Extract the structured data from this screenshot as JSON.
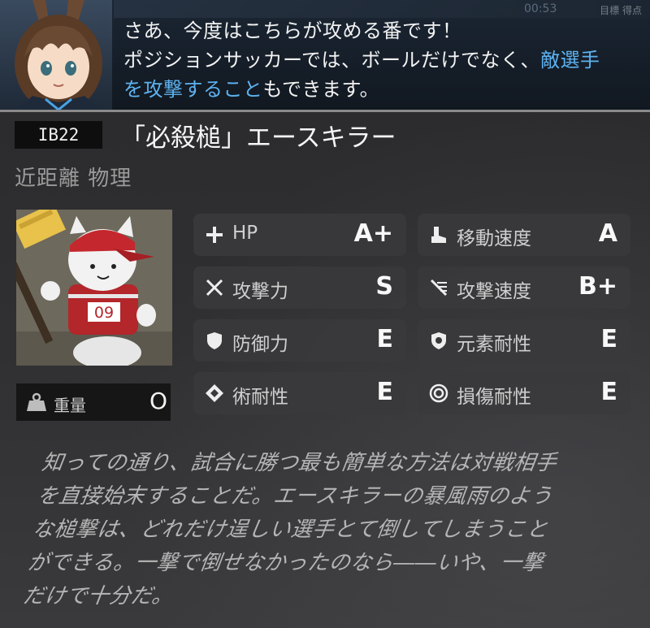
{
  "dialog": {
    "hud_timer": "00:53",
    "hud_score": "目標 得点",
    "line1": "さあ、今度はこちらが攻める番です！",
    "line2_a": "ポジションサッカーでは、ボールだけでなく、",
    "line2_hl": "敵選手",
    "line3_hl": "を攻撃すること",
    "line3_b": "もできます。"
  },
  "unit": {
    "code": "IB22",
    "name": "「必殺槌」エースキラー",
    "tags": "近距離 物理"
  },
  "card": {
    "jersey_number": "09"
  },
  "weight": {
    "label": "重量",
    "value": "O"
  },
  "stats": [
    {
      "icon": "plus-icon",
      "label": "HP",
      "value": "A+"
    },
    {
      "icon": "boot-icon",
      "label": "移動速度",
      "value": "A"
    },
    {
      "icon": "crossed-swords-icon",
      "label": "攻撃力",
      "value": "S"
    },
    {
      "icon": "attack-speed-icon",
      "label": "攻撃速度",
      "value": "B+"
    },
    {
      "icon": "shield-icon",
      "label": "防御力",
      "value": "E"
    },
    {
      "icon": "element-res-icon",
      "label": "元素耐性",
      "value": "E"
    },
    {
      "icon": "arts-res-icon",
      "label": "術耐性",
      "value": "E"
    },
    {
      "icon": "damage-res-icon",
      "label": "損傷耐性",
      "value": "E"
    }
  ],
  "description": [
    "知っての通り、試合に勝つ最も簡単な方法は対戦相手",
    "を直接始末することだ。エースキラーの暴風雨のよう",
    "な槌撃は、どれだけ逞しい選手とて倒してしまうこと",
    "ができる。一撃で倒せなかったのなら――いや、一撃",
    "だけで十分だ。"
  ],
  "colors": {
    "highlight": "#5db2f0",
    "panel": "#3a3a3c",
    "dialog_bg": "#151d27"
  }
}
